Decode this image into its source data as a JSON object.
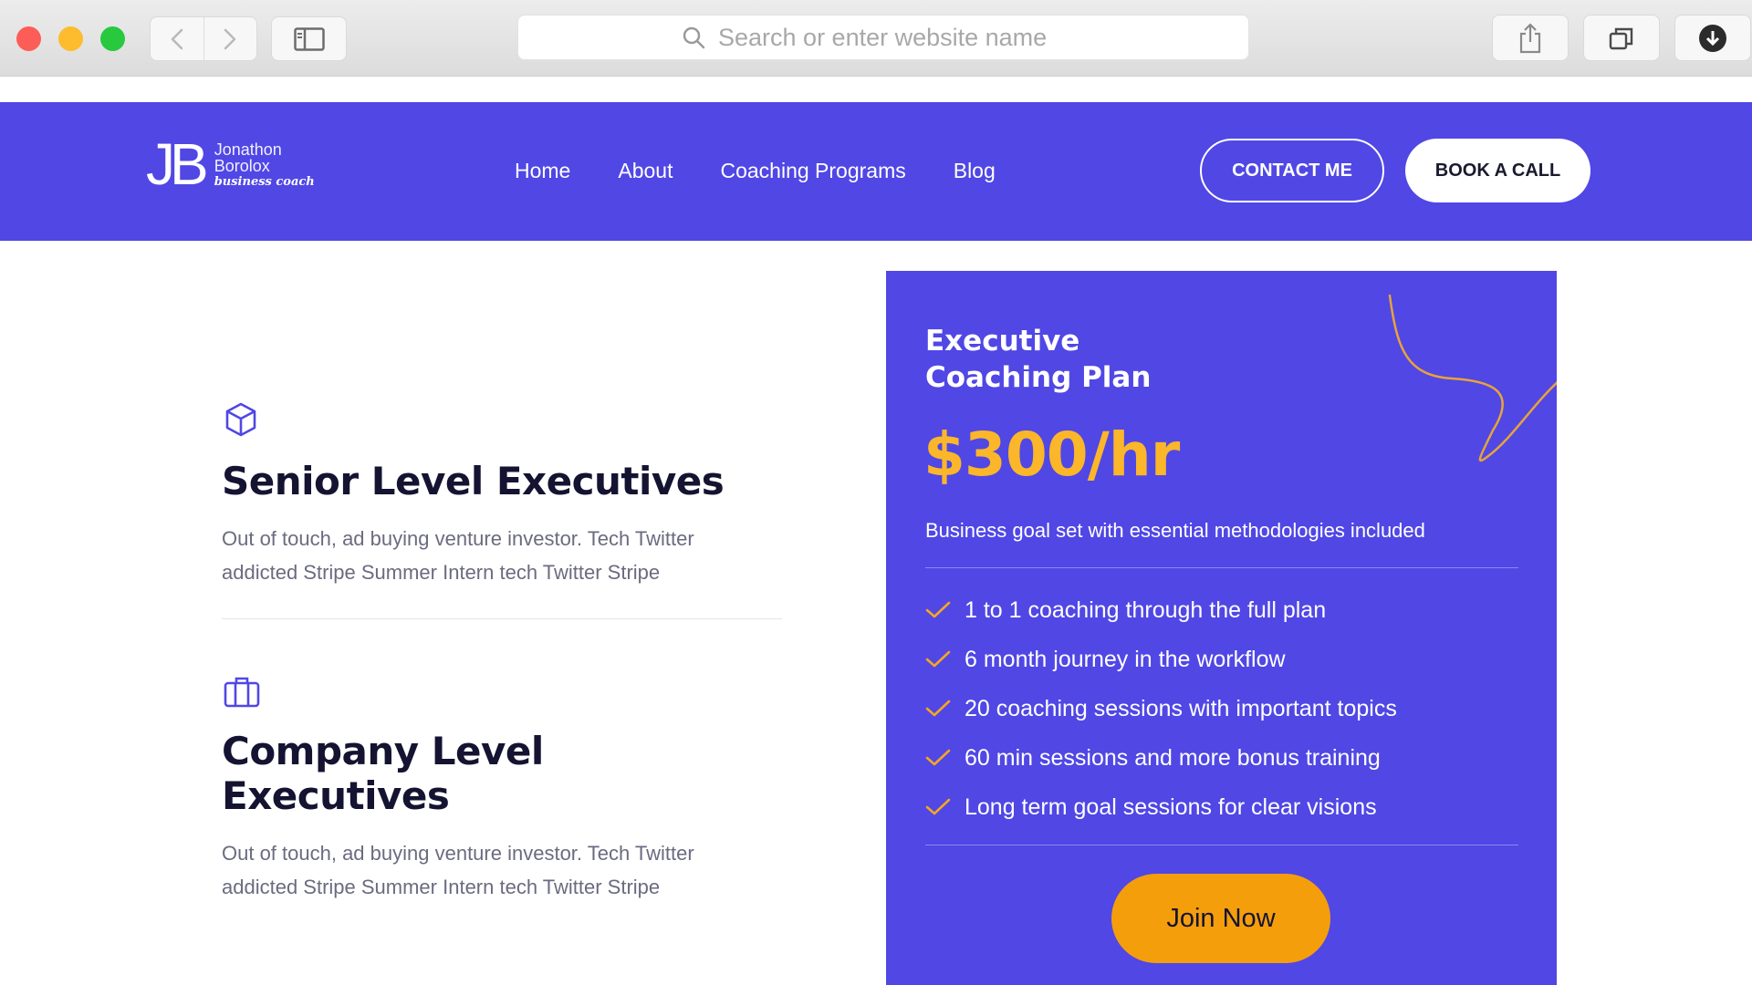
{
  "browser": {
    "url_placeholder": "Search or enter website name",
    "icons": [
      "back-arrow-icon",
      "forward-arrow-icon",
      "sidebar-icon",
      "search-icon",
      "share-icon",
      "tabs-icon",
      "download-icon"
    ]
  },
  "header": {
    "logo_mark": "JB",
    "logo_name_line1": "Jonathon",
    "logo_name_line2": "Borolox",
    "logo_tagline": "business coach",
    "nav": [
      "Home",
      "About",
      "Coaching Programs",
      "Blog"
    ],
    "contact_label": "CONTACT ME",
    "book_label": "BOOK A CALL",
    "background_color": "#5047e5"
  },
  "features": [
    {
      "icon": "cube-icon",
      "title": "Senior Level Executives",
      "description_line1": "Out of touch, ad buying venture investor. Tech Twitter",
      "description_line2": "addicted Stripe Summer Intern tech Twitter Stripe"
    },
    {
      "icon": "briefcase-icon",
      "title": "Company Level Executives",
      "description_line1": "Out of touch, ad buying venture investor. Tech Twitter",
      "description_line2": "addicted Stripe Summer Intern tech Twitter Stripe"
    }
  ],
  "plan": {
    "name_line1": "Executive",
    "name_line2": "Coaching Plan",
    "price": "$300/hr",
    "description": "Business goal set with essential methodologies included",
    "features": [
      "1 to 1 coaching through the full plan",
      "6 month journey in the workflow",
      "20 coaching sessions with important topics",
      "60 min sessions and more bonus training",
      "Long term goal sessions for clear visions"
    ],
    "cta_label": "Join Now",
    "accent_color": "#fbb62a",
    "cta_color": "#f59e0b"
  }
}
